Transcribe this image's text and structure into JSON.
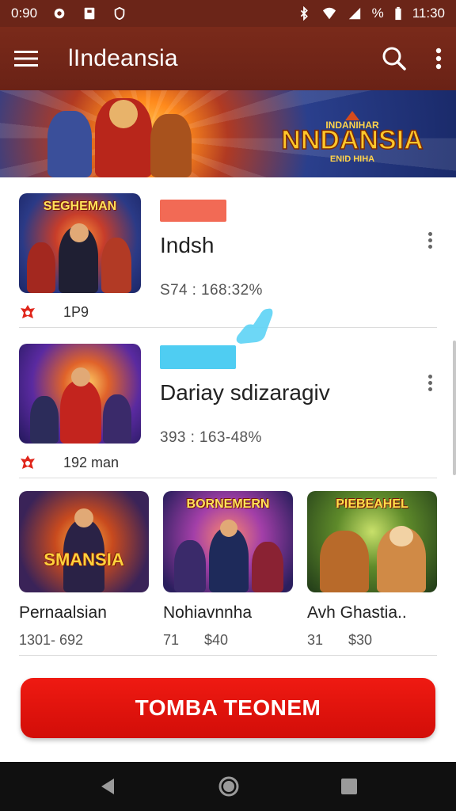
{
  "status_bar": {
    "time_left": "0:90",
    "battery_text": "%",
    "time_right": "11:30"
  },
  "app_bar": {
    "title": "lIndeansia"
  },
  "banner": {
    "logo_text": "NNDANSIA",
    "logo_top": "INDANIHAR",
    "logo_sub": "ENID HIHA"
  },
  "list_items": [
    {
      "thumb_caption": "SEGHEMAN",
      "title": "Indsh",
      "meta": "S74 : 168:32%",
      "badge": "1P9",
      "tag_color": "#f26a55"
    },
    {
      "thumb_caption": "",
      "title": "Dariay sdizaragiv",
      "meta": "393 : 163-48%",
      "badge": "192 man",
      "tag_color": "#4fcdf2"
    }
  ],
  "grid": [
    {
      "thumb_caption": "SMANSIA",
      "title": "Pernaalsian",
      "meta_left": "1301- 692",
      "meta_right": ""
    },
    {
      "thumb_caption": "BORNEMERN",
      "title": "Nohiavnnha",
      "meta_left": "71",
      "meta_right": "$40"
    },
    {
      "thumb_caption": "PIEBEAHEL",
      "title": "Avh Ghastia..",
      "meta_left": "31",
      "meta_right": "$30"
    }
  ],
  "cta": {
    "label": "TOMBA TEONEM"
  },
  "colors": {
    "app_bar": "#7a2a1a",
    "cta": "#e31510",
    "accent_tag": "#f26a55",
    "tag_blue": "#4fcdf2"
  }
}
